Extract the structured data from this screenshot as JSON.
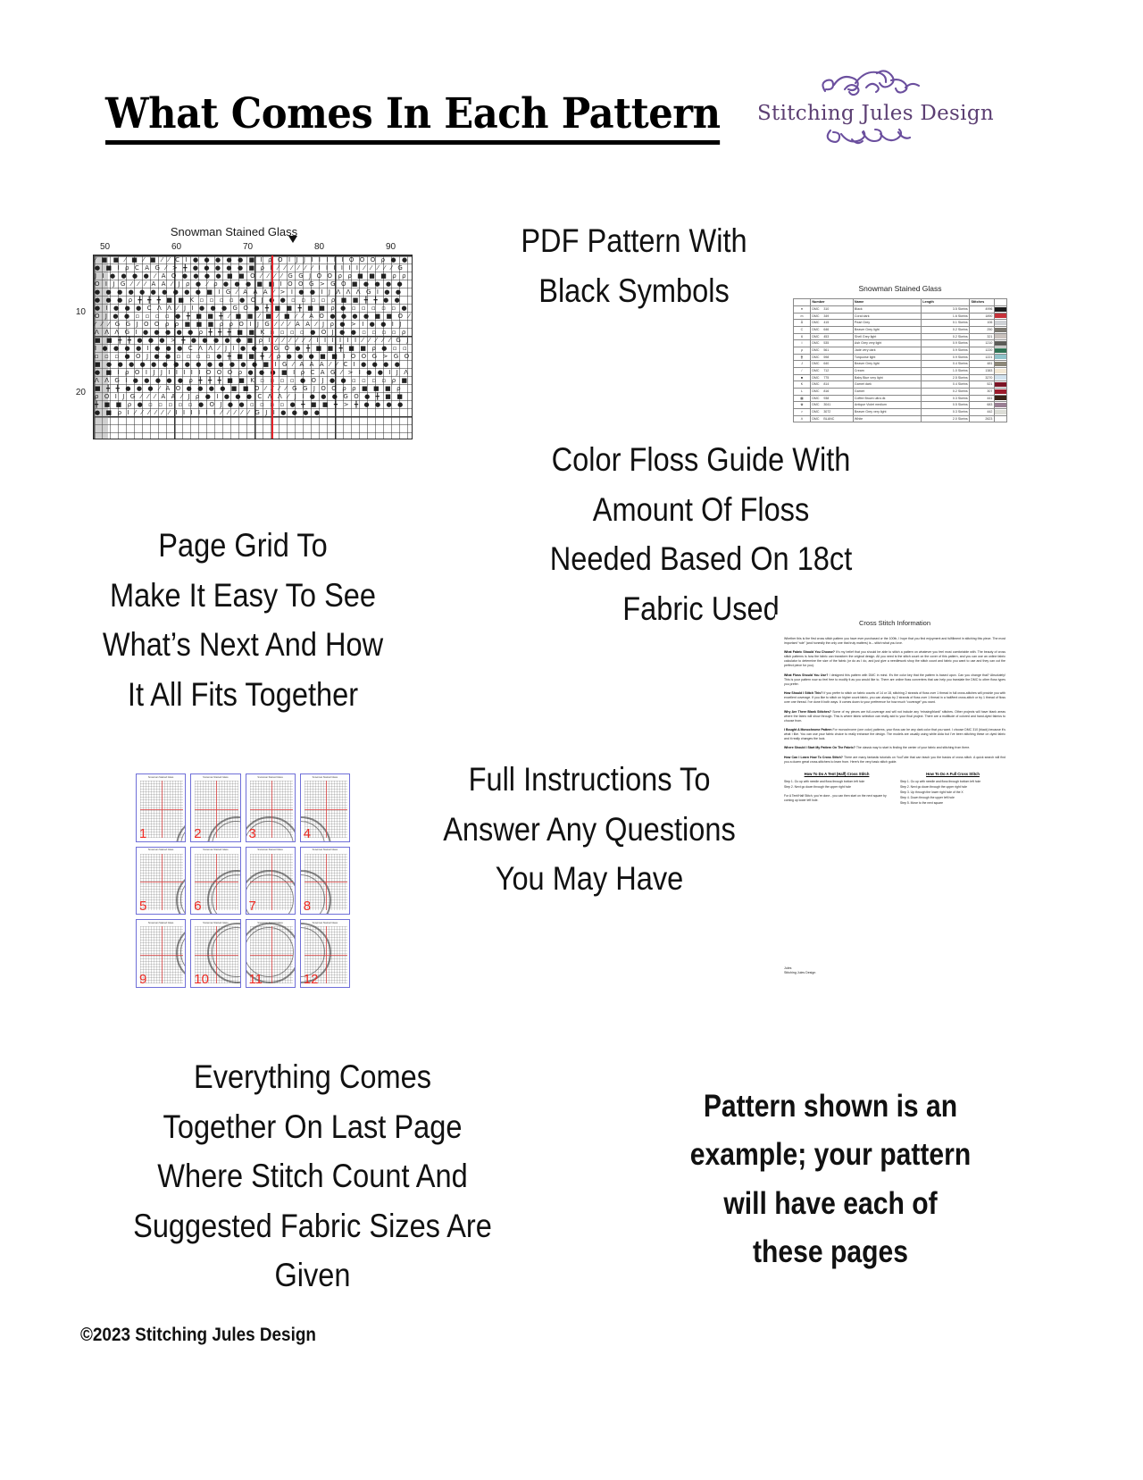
{
  "header": {
    "title": "What Comes In Each Pattern",
    "logo": {
      "name": "Stitching Jules Design",
      "flourish_top": "❦〰❧",
      "flourish_bottom": "❦〰❧",
      "color": "#6b4f9e"
    }
  },
  "captions": {
    "pdf_pattern": "PDF Pattern With\nBlack Symbols",
    "page_grid": "Page Grid To\nMake It Easy To See\nWhat’s Next And How\nIt All Fits Together",
    "floss_guide": "Color Floss Guide With\nAmount Of Floss\nNeeded Based On 18ct\nFabric Used",
    "instructions": "Full Instructions To\nAnswer Any Questions\nYou May Have",
    "last_page": "Everything Comes\nTogether On Last Page\nWhere Stitch Count And\nSuggested Fabric Sizes Are\nGiven",
    "disclaimer": "Pattern shown is an\nexample; your pattern\nwill have each of\nthese pages"
  },
  "chart": {
    "title": "Snowman Stained Glass",
    "column_labels": [
      "50",
      "60",
      "70",
      "80",
      "90"
    ],
    "row_labels": [
      "10",
      "20"
    ],
    "center_marker_color": "#e8232a",
    "symbol_rows": [
      "        ⁄ ■ ■ ⁄ ■ ⁄ ■ ⁄ ",
      "    ⁄ C I ● ● ● ● ● ■ I ρ O I J J I I I I I O O O ρ ● ● ● ■ I ρ C A G ⁄",
      "  > ╋ ● ● ● ● ● ■ ρ I ⁄ ⁄ ⁄ ⁄ ⁄ ⁄ I I I I I I ⁄ ⁄ ⁄ ⁄ ⁄ G J I ● ● ● ●",
      "⁄ A O ● ● ● ● ■ ■ O ⁄ ⁄ ⁄ ⁄ G G J O O ρ ρ ■ ■ ■ ρ ρ O I J G ⁄ ⁄ ⁄ A A ⁄ J ρ ●",
      "⁄ ρ ● ● ● ■ ■ I O O G > G O ■ ● ● ● ● ● ● ● ● ● ● ● ● ● ● ■ I G ⁄ A A A ⁄",
      "> I ● ● I J Λ Λ Λ G I ● ● ● ● ● ρ ╋ ╋ ╋ ■ ■ K ▫ ▫ ▫ ▫ ● O J ● ● ▫ ▫ ▫ ▫ ρ ■ ■ ╋ ╋ ● ● ●",
      "I ● ● ● C Λ Λ ⁄ J I ● ● ● G O ● ╋ ■ ■ ╋ ■ ■ ρ ● ▫ ▫ ▫ ▫ ▫ ● O J ● ● ▫ ▫ ▫ ▫ ● ╋ ■ ■ ╋"
    ]
  },
  "floss_table": {
    "title": "Snowman Stained Glass",
    "headers": [
      "",
      "Number",
      "Name",
      "Length",
      "Stitches",
      ""
    ],
    "rows": [
      {
        "symbol": "●",
        "number": "310",
        "name": "Black",
        "length": "3.5 Skeins",
        "stitches": "4996",
        "color": "#1a1a1a"
      },
      {
        "symbol": "m",
        "number": "349",
        "name": "Coral dark",
        "length": "1.6 Skeins",
        "stitches": "1890",
        "color": "#c6323a"
      },
      {
        "symbol": "Å",
        "number": "415",
        "name": "Pearl Grey",
        "length": "0.1 Skeins",
        "stitches": "106",
        "color": "#cfd2d6"
      },
      {
        "symbol": "C",
        "number": "646",
        "name": "Beaver Grey light",
        "length": "0.2 Skeins",
        "stitches": "250",
        "color": "#7d7a72"
      },
      {
        "symbol": "6",
        "number": "453",
        "name": "Shell Grey light",
        "length": "0.2 Skeins",
        "stitches": "321",
        "color": "#c9c2bd"
      },
      {
        "symbol": "I",
        "number": "535",
        "name": "Ash Grey very light",
        "length": "0.9 Skeins",
        "stitches": "1210",
        "color": "#5c5c58"
      },
      {
        "symbol": "ρ",
        "number": "561",
        "name": "Jade very dark",
        "length": "0.9 Skeins",
        "stitches": "1220",
        "color": "#2f7355"
      },
      {
        "symbol": "╋",
        "number": "598",
        "name": "Turquoise light",
        "length": "0.9 Skeins",
        "stitches": "1221",
        "color": "#8fc3ca"
      },
      {
        "symbol": "J",
        "number": "640",
        "name": "Beaver Grey light",
        "length": "0.4 Skeins",
        "stitches": "481",
        "color": "#8d8879"
      },
      {
        "symbol": "⁄",
        "number": "712",
        "name": "Cream",
        "length": "1.0 Skeins",
        "stitches": "1383",
        "color": "#f2e8d5"
      },
      {
        "symbol": "■",
        "number": "775",
        "name": "Baby Blue very light",
        "length": "2.5 Skeins",
        "stitches": "3270",
        "color": "#d2e2ee"
      },
      {
        "symbol": "K",
        "number": "814",
        "name": "Garnet dark",
        "length": "0.4 Skeins",
        "stitches": "521",
        "color": "#7c1425"
      },
      {
        "symbol": "L",
        "number": "816",
        "name": "Garnet",
        "length": "0.2 Skeins",
        "stitches": "307",
        "color": "#9c1b2c"
      },
      {
        "symbol": "▩",
        "number": "938",
        "name": "Coffee Brown ultra dk",
        "length": "0.3 Skeins",
        "stitches": "441",
        "color": "#3a2318"
      },
      {
        "symbol": "✿",
        "number": "3041",
        "name": "Antique Violet medium",
        "length": "0.5 Skeins",
        "stitches": "683",
        "color": "#9a7f94"
      },
      {
        "symbol": ">",
        "number": "3072",
        "name": "Beaver Grey very light",
        "length": "0.3 Skeins",
        "stitches": "442",
        "color": "#dcddd7"
      },
      {
        "symbol": "Λ",
        "number": "BLANC",
        "name": "White",
        "length": "2.0 Skeins",
        "stitches": "2623",
        "color": "#ffffff"
      }
    ]
  },
  "page_grid": {
    "numbers": [
      "1",
      "2",
      "3",
      "4",
      "5",
      "6",
      "7",
      "8",
      "9",
      "10",
      "11",
      "12"
    ],
    "page_title": "Snowman Stained Glass",
    "border_color": "#6f6fd8",
    "number_color": "#ef2b24"
  },
  "instructions": {
    "title": "Cross Stitch Information",
    "intro": "Whether this is the first cross stitch pattern you have ever purchased or the 100th, I hope that you find enjoyment and fulfillment in stitching this piece. The most important “rule” (and honestly the only one that truly matters) is – stitch what you love.",
    "intro_emphasis": "stitch what you love",
    "sections": [
      {
        "heading": "What Fabric Should You Choose?",
        "text": " It’s my belief that you should be able to stitch a pattern on whatever you feel most comfortable with. The beauty of cross stitch patterns is how the fabric can transform the original design. All you need is the stitch count on the cover of this pattern, and you can use an online fabric calculator to determine the size of the fabric (or do as I do, and just give a needlework shop the stitch count and fabric you want to use and they can cut the perfect piece for you)."
      },
      {
        "heading": "What Floss Should You Use?",
        "text": " I designed this pattern with DMC in mind. It’s the color key that the pattern is based upon. Can you change that? Absolutely! This is your pattern now so feel free to modify it as you would like to. There are online floss converters that can help you translate the DMC to other floss types you prefer."
      },
      {
        "heading": "How Should I Stitch This?",
        "text": " If you prefer to stitch on fabric counts of 14 or 18, stitching 2 strands of floss over 1 thread in full cross-stitches will provide you with excellent coverage. If you like to stitch on higher count fabric, you can always try 2 strands of floss over 1 thread in a half/tent cross-stitch or try 1 thread of floss over one thread. I’ve done it both ways. It comes down to your preference for how much “coverage” you want."
      },
      {
        "heading": "Why Are There Blank Stitches?",
        "text": " Some of my pieces are full-coverage and will not include any “missing/blank” stitches. Other projects will have blank areas where the fabric will show through. This is where fabric selection can really add to your final project. There are a multitude of colored and hand-dyed fabrics to choose from."
      },
      {
        "heading": "I Bought A Monochrome Pattern",
        "text": " For monochrome (one color) patterns, your floss can be any dark color that you want. I choose DMC 310 (black) because it’s what I like. You can use your fabric choice to really enhance the design. The models are usually using white Aida but I’ve been stitching these on dyed fabric and it really changes the look."
      },
      {
        "heading": "Where Should I Start My Pattern On The Fabric?",
        "text": " The classic way to start is finding the center of your fabric and stitching from there."
      },
      {
        "heading": "How Can I Learn How To Cross Stitch?",
        "text": " There are many fantastic tutorials on YouTube that can teach you the basics of cross stitch. A quick search will find you a dozen great cross-stitchers to learn from. Here’s the very basic stitch guide."
      }
    ],
    "howto_half": {
      "heading": "How To Do A Tent (Half) Cross Stitch",
      "steps": [
        "Step 1. Go up with needle and floss through bottom left hole",
        "Step 2. Next go down through the upper right hole"
      ],
      "note": "For A Tent/Half Stitch, you’re done - you can then start on the next square by coming up lower left hole."
    },
    "howto_full": {
      "heading": "How To Do A Full Cross Stitch",
      "steps": [
        "Step 1. Go up with needle and floss through bottom left hole",
        "Step 2. Next go down through the upper right hole",
        "Step 3. Up through the lower right hole of the X",
        "Step 4. Down through the upper left hole",
        "Step 5. Move to the next square"
      ]
    },
    "signature": [
      "Jules",
      "Stitching Jules Design"
    ]
  },
  "footer": {
    "copyright": "©2023 Stitching Jules Design"
  }
}
